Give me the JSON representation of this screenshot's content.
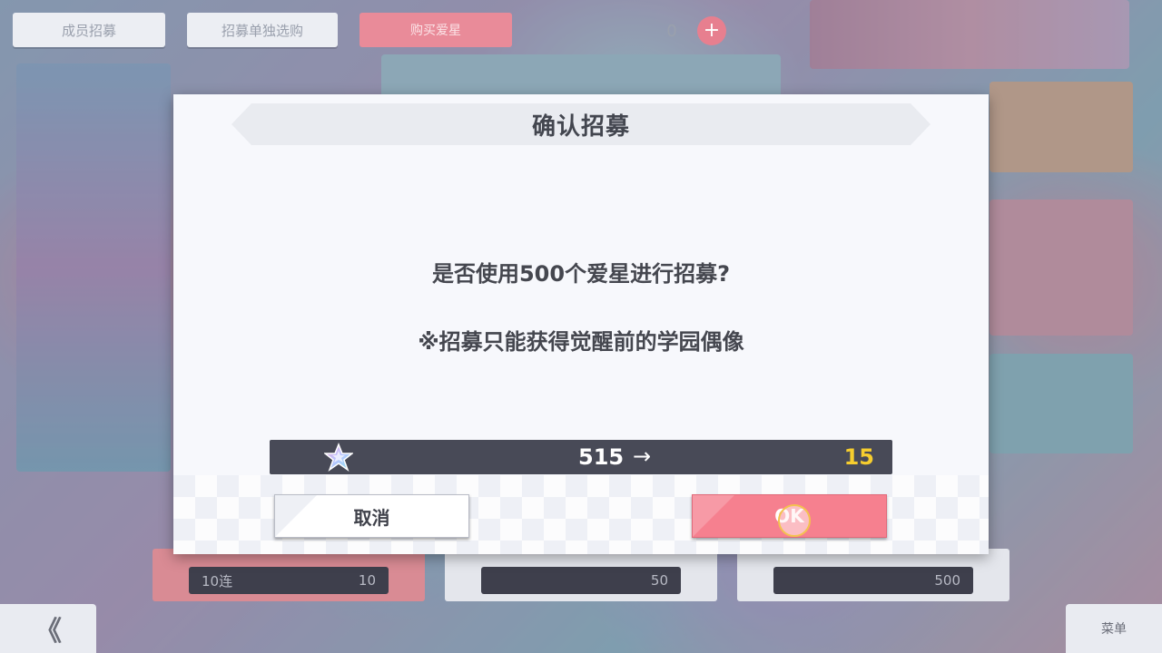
{
  "background": {
    "top_tabs": [
      "成员招募",
      "招募单独选购"
    ],
    "top_red_button": "购买爱星",
    "currency_count": "0",
    "bottom_card_values": [
      "10",
      "50",
      "500"
    ],
    "bottom_card_labels": [
      "10连",
      "",
      ""
    ],
    "back_glyph": "《",
    "menu_label": "菜单"
  },
  "dialog": {
    "title": "确认招募",
    "message": "是否使用500个爱星进行招募?",
    "note": "※招募只能获得觉醒前的学园偶像",
    "cost": {
      "icon": "love-star-icon",
      "from": "515",
      "arrow": "→",
      "to": "15"
    },
    "cancel_label": "取消",
    "ok_label": "OK"
  },
  "colors": {
    "ok_button": "#f6808f",
    "cost_bar": "#484a57",
    "cost_result": "#f6cd2e"
  }
}
